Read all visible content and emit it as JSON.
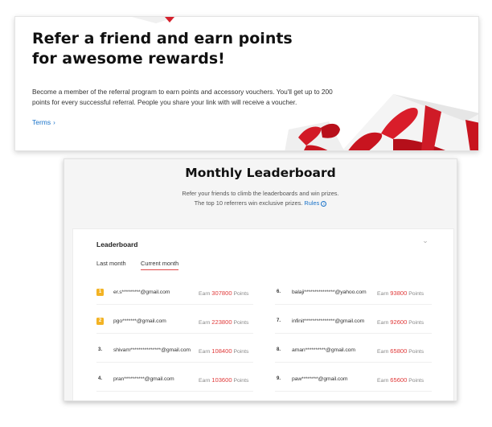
{
  "referral": {
    "title": "Refer a friend and earn points for awesome rewards!",
    "body": "Become a member of the referral program to earn points and accessory vouchers. You'll get up to 200 points for every successful referral. People you share your link with will receive a voucher.",
    "terms_label": "Terms",
    "terms_icon": "chevron-right-icon"
  },
  "leaderboard": {
    "title": "Monthly Leaderboard",
    "subtitle_line1": "Refer your friends to climb the leaderboards and win prizes.",
    "subtitle_line2": "The top 10 referrers win exclusive prizes.",
    "rules_label": "Rules",
    "card_title": "Leaderboard",
    "tabs": {
      "last_month": "Last month",
      "current_month": "Current month"
    },
    "earn_label": "Earn",
    "points_label": "Points",
    "medal_color": "#f3b324",
    "points_color": "#e03a3a",
    "entries": [
      {
        "rank": "1",
        "email": "er.s*********@gmail.com",
        "points": "307800"
      },
      {
        "rank": "2",
        "email": "pgo*******@gmail.com",
        "points": "223800"
      },
      {
        "rank": "3.",
        "email": "shivam***************@gmail.com",
        "points": "108400"
      },
      {
        "rank": "4.",
        "email": "pran**********@gmail.com",
        "points": "103600"
      },
      {
        "rank": "6.",
        "email": "balaji***************@yahoo.com",
        "points": "93800"
      },
      {
        "rank": "7.",
        "email": "infinit***************@gmail.com",
        "points": "92600"
      },
      {
        "rank": "8.",
        "email": "aman**********@gmail.com",
        "points": "65800"
      },
      {
        "rank": "9.",
        "email": "paw********@gmail.com",
        "points": "65600"
      }
    ]
  }
}
